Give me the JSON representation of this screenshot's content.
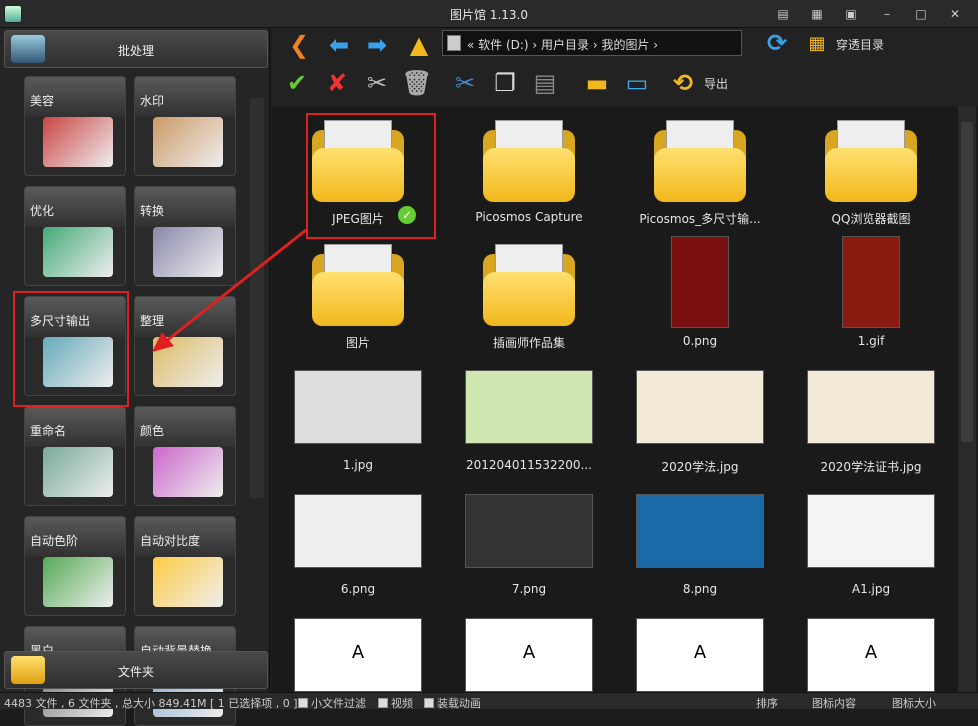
{
  "window": {
    "title": "图片馆 1.13.0"
  },
  "left_panel": {
    "batch_label": "批处理",
    "folder_label": "文件夹",
    "tiles": [
      {
        "label": "美容"
      },
      {
        "label": "水印"
      },
      {
        "label": "优化"
      },
      {
        "label": "转换"
      },
      {
        "label": "多尺寸输出"
      },
      {
        "label": "整理"
      },
      {
        "label": "重命名"
      },
      {
        "label": "颜色"
      },
      {
        "label": "自动色阶"
      },
      {
        "label": "自动对比度"
      },
      {
        "label": "黑白"
      },
      {
        "label": "自动背景替换"
      }
    ]
  },
  "toolbar": {
    "address": "« 软件 (D:) › 用户目录 › 我的图片 ›",
    "through_label": "穿透目录",
    "export_label": "导出"
  },
  "items": [
    {
      "name": "JPEG图片",
      "kind": "folder"
    },
    {
      "name": "Picosmos Capture",
      "kind": "folder"
    },
    {
      "name": "Picosmos_多尺寸输...",
      "kind": "folder"
    },
    {
      "name": "QQ浏览器截图",
      "kind": "folder"
    },
    {
      "name": "图片",
      "kind": "folder"
    },
    {
      "name": "插画师作品集",
      "kind": "folder"
    },
    {
      "name": "0.png",
      "kind": "image"
    },
    {
      "name": "1.gif",
      "kind": "image"
    },
    {
      "name": "1.jpg",
      "kind": "image"
    },
    {
      "name": "201204011532200...",
      "kind": "image"
    },
    {
      "name": "2020学法.jpg",
      "kind": "image"
    },
    {
      "name": "2020学法证书.jpg",
      "kind": "image"
    },
    {
      "name": "6.png",
      "kind": "image"
    },
    {
      "name": "7.png",
      "kind": "image"
    },
    {
      "name": "8.png",
      "kind": "image"
    },
    {
      "name": "A1.jpg",
      "kind": "image"
    },
    {
      "name": "A",
      "kind": "image"
    },
    {
      "name": "A",
      "kind": "image"
    },
    {
      "name": "A",
      "kind": "image"
    },
    {
      "name": "A",
      "kind": "image"
    }
  ],
  "status": {
    "summary": "4483 文件 , 6 文件夹 , 总大小 849.41M [ 1 已选择项 , 0 ]",
    "small_filter": "小文件过滤",
    "video": "视频",
    "animation": "装载动画",
    "sort": "排序",
    "icon_content": "图标内容",
    "icon_size": "图标大小"
  },
  "colors": {
    "accent_red": "#e02020",
    "folder_yellow": "#f2b81c"
  }
}
